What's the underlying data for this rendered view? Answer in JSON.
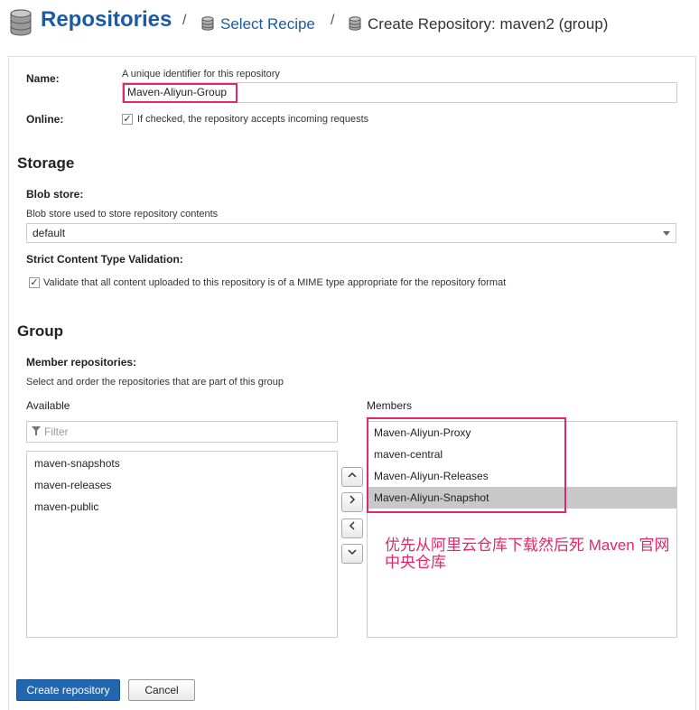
{
  "breadcrumb": {
    "title": "Repositories",
    "separator": "/",
    "recipe": "Select Recipe",
    "create": "Create Repository: maven2 (group)"
  },
  "form": {
    "name_label": "Name:",
    "name_help": "A unique identifier for this repository",
    "name_value": "Maven-Aliyun-Group",
    "online_label": "Online:",
    "online_checked": true,
    "online_help": "If checked, the repository accepts incoming requests"
  },
  "storage": {
    "title": "Storage",
    "blob_label": "Blob store:",
    "blob_help": "Blob store used to store repository contents",
    "blob_value": "default",
    "strict_label": "Strict Content Type Validation:",
    "strict_checked": true,
    "strict_help": "Validate that all content uploaded to this repository is of a MIME type appropriate for the repository format"
  },
  "group": {
    "title": "Group",
    "members_label": "Member repositories:",
    "members_help": "Select and order the repositories that are part of this group",
    "available_header": "Available",
    "members_header": "Members",
    "filter_placeholder": "Filter",
    "available": [
      "maven-snapshots",
      "maven-releases",
      "maven-public"
    ],
    "members": [
      "Maven-Aliyun-Proxy",
      "maven-central",
      "Maven-Aliyun-Releases",
      "Maven-Aliyun-Snapshot"
    ],
    "selected_member": "Maven-Aliyun-Snapshot",
    "buttons": {
      "up": "⌃",
      "right": "›",
      "left": "‹",
      "down": "⌄"
    }
  },
  "annotation": {
    "line1": "优先从阿里云仓库下载然后死 Maven 官网",
    "line2": "中央仓库",
    "color": "#e4266d"
  },
  "actions": {
    "create": "Create repository",
    "cancel": "Cancel"
  },
  "colors": {
    "brand": "#1a5aa6",
    "primary_button": "#2067b0",
    "highlight": "#e4266d",
    "selected_row": "#c8c8c8"
  },
  "icons": {
    "database": "database-icon",
    "filter": "filter-icon",
    "check": "checkmark-icon"
  }
}
